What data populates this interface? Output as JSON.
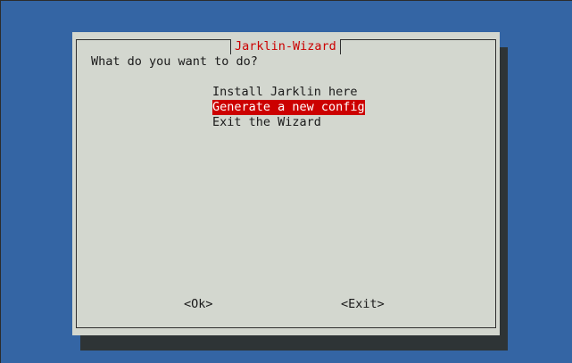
{
  "dialog": {
    "title": "Jarklin-Wizard",
    "prompt": "What do you want to do?",
    "menu_items": [
      {
        "label": "Install Jarklin here",
        "selected": false
      },
      {
        "label": "Generate a new config",
        "selected": true
      },
      {
        "label": "Exit the Wizard",
        "selected": false
      }
    ],
    "buttons": {
      "ok_label": "<Ok>",
      "exit_label": "<Exit>"
    }
  },
  "colors": {
    "background": "#3465a4",
    "dialog_bg": "#d3d7cf",
    "shadow": "#2e3436",
    "title_text": "#cc0000",
    "selection_bg": "#cc0000",
    "selection_text": "#ffffff"
  }
}
